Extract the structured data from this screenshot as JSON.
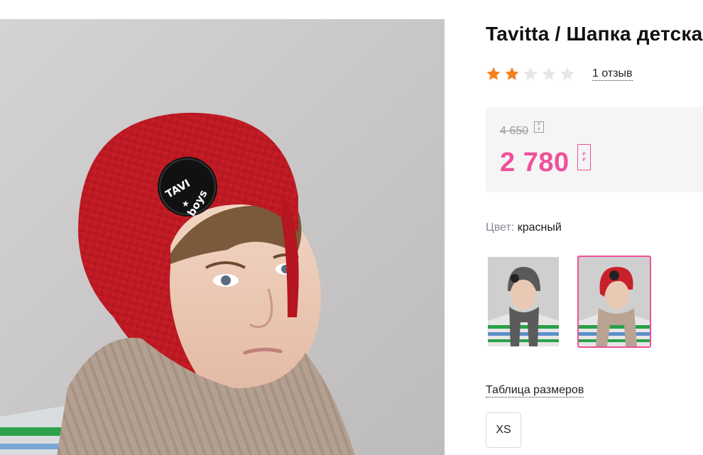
{
  "product": {
    "title": "Tavitta / Шапка детская",
    "patch_text_top": "TAVI",
    "patch_text_bottom": "boys"
  },
  "rating": {
    "value": 2,
    "max": 5,
    "reviews_label": "1 отзыв",
    "filled_color": "#f5821f",
    "empty_color": "#e6e6e6"
  },
  "price": {
    "old": "4 650",
    "new": "2 780",
    "currency_glyph_lines": [
      "₽",
      "₽"
    ],
    "accent_color": "#f0509a"
  },
  "color": {
    "label": "Цвет:",
    "value": "красный",
    "swatches": [
      {
        "name": "grey",
        "selected": false
      },
      {
        "name": "red",
        "selected": true
      }
    ]
  },
  "sizes": {
    "table_label": "Таблица размеров",
    "options": [
      "XS"
    ]
  }
}
